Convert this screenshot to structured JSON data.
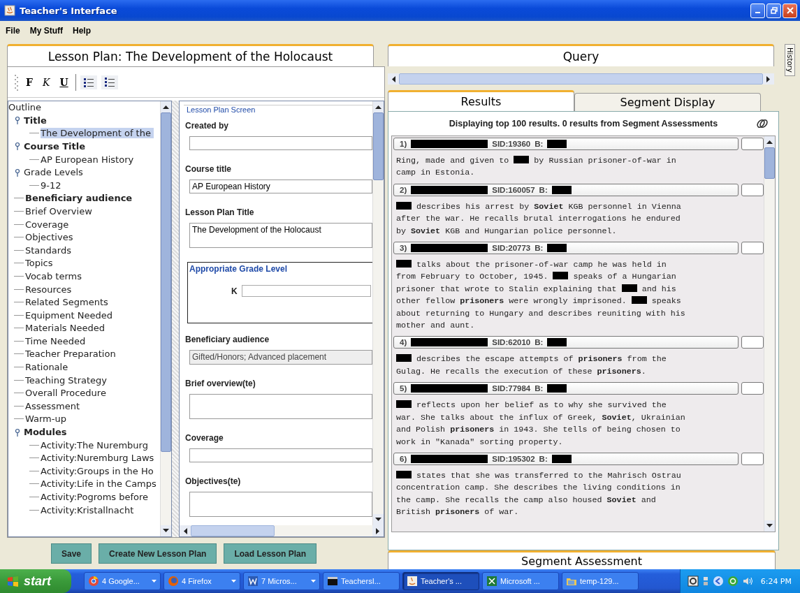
{
  "window": {
    "title": "Teacher's Interface"
  },
  "menu": [
    "File",
    "My Stuff",
    "Help"
  ],
  "lesson_tab": {
    "title": "Lesson Plan: The Development of the Holocaust"
  },
  "toolbar": [
    {
      "kind": "bold",
      "label": "F"
    },
    {
      "kind": "italic",
      "label": "K"
    },
    {
      "kind": "underline",
      "label": "U"
    },
    {
      "kind": "bullets"
    },
    {
      "kind": "numbers"
    }
  ],
  "outline": {
    "title": "Outline",
    "items": [
      {
        "label": "Title",
        "bold": true,
        "selected": false,
        "expanded": true,
        "children": [
          {
            "label": "The Development of the",
            "bold": false,
            "selected": true
          }
        ]
      },
      {
        "label": "Course Title",
        "bold": true,
        "selected": false,
        "expanded": true,
        "children": [
          {
            "label": "AP European History",
            "bold": false,
            "selected": false
          }
        ]
      },
      {
        "label": "Grade Levels",
        "bold": false,
        "selected": false,
        "expanded": true,
        "children": [
          {
            "label": "9-12",
            "bold": false,
            "selected": false
          }
        ]
      },
      {
        "label": "Beneficiary audience",
        "bold": true,
        "selected": false
      },
      {
        "label": "Brief Overview",
        "bold": false,
        "selected": false
      },
      {
        "label": "Coverage",
        "bold": false,
        "selected": false
      },
      {
        "label": "Objectives",
        "bold": false,
        "selected": false
      },
      {
        "label": "Standards",
        "bold": false,
        "selected": false
      },
      {
        "label": "Topics",
        "bold": false,
        "selected": false
      },
      {
        "label": "Vocab terms",
        "bold": false,
        "selected": false
      },
      {
        "label": "Resources",
        "bold": false,
        "selected": false
      },
      {
        "label": "Related Segments",
        "bold": false,
        "selected": false
      },
      {
        "label": "Equipment Needed",
        "bold": false,
        "selected": false
      },
      {
        "label": "Materials Needed",
        "bold": false,
        "selected": false
      },
      {
        "label": "Time Needed",
        "bold": false,
        "selected": false
      },
      {
        "label": "Teacher Preparation",
        "bold": false,
        "selected": false
      },
      {
        "label": "Rationale",
        "bold": false,
        "selected": false
      },
      {
        "label": "Teaching Strategy",
        "bold": false,
        "selected": false
      },
      {
        "label": "Overall Procedure",
        "bold": false,
        "selected": false
      },
      {
        "label": "Assessment",
        "bold": false,
        "selected": false
      },
      {
        "label": "Warm-up",
        "bold": false,
        "selected": false
      },
      {
        "label": "Modules",
        "bold": true,
        "selected": false,
        "expanded": true,
        "children": [
          {
            "label": "Activity:The Nuremburg",
            "bold": false,
            "selected": false
          },
          {
            "label": "Activity:Nuremburg Laws",
            "bold": false,
            "selected": false
          },
          {
            "label": "Activity:Groups in the Ho",
            "bold": false,
            "selected": false
          },
          {
            "label": "Activity:Life in the Camps",
            "bold": false,
            "selected": false
          },
          {
            "label": "Activity:Pogroms before",
            "bold": false,
            "selected": false
          },
          {
            "label": "Activity:Kristallnacht",
            "bold": false,
            "selected": false
          }
        ]
      }
    ]
  },
  "form": {
    "title": "Lesson Plan Screen",
    "fields": [
      {
        "kind": "input",
        "label": "Created by"
      },
      {
        "kind": "input",
        "label": "Course title",
        "value": "AP European History"
      },
      {
        "kind": "textarea",
        "label": "Lesson Plan Title",
        "value": "The Development of the Holocaust"
      },
      {
        "kind": "group",
        "label": "Appropriate Grade Level",
        "field_label": "K"
      },
      {
        "kind": "input",
        "label": "Beneficiary audience",
        "value": "Gifted/Honors; Advanced placement",
        "disabled": true
      },
      {
        "kind": "textarea",
        "label": "Brief overview(te)"
      },
      {
        "kind": "input",
        "label": "Coverage"
      },
      {
        "kind": "textarea",
        "label": "Objectives(te)"
      }
    ]
  },
  "buttons": [
    "Save",
    "Create New Lesson Plan",
    "Load Lesson Plan"
  ],
  "query_tab": {
    "title": "Query"
  },
  "result_tabs": [
    {
      "label": "Results",
      "selected": true
    },
    {
      "label": "Segment Display",
      "selected": false
    }
  ],
  "results": {
    "summary": "Displaying top 100 results. 0 results from Segment Assessments",
    "items": [
      {
        "number": "1)",
        "sid": "SID:19360",
        "b": "B:",
        "parts": [
          {
            "kind": "text",
            "text": "Ring, made and given to "
          },
          {
            "kind": "redacted"
          },
          {
            "kind": "text",
            "text": " by Russian prisoner-of-war in camp in Estonia."
          }
        ]
      },
      {
        "number": "2)",
        "sid": "SID:160057",
        "b": "B:",
        "parts": [
          {
            "kind": "redacted"
          },
          {
            "kind": "text",
            "text": " describes his arrest by **Soviet** KGB personnel in Vienna after the war. He recalls brutal interrogations he endured by **Soviet** KGB and Hungarian police personnel."
          }
        ]
      },
      {
        "number": "3)",
        "sid": "SID:20773",
        "b": "B:",
        "parts": [
          {
            "kind": "redacted"
          },
          {
            "kind": "text",
            "text": " talks about the prisoner-of-war camp he was held in from February to October, 1945. "
          },
          {
            "kind": "redacted"
          },
          {
            "kind": "text",
            "text": " speaks of a Hungarian prisoner that wrote to Stalin explaining that "
          },
          {
            "kind": "redacted"
          },
          {
            "kind": "text",
            "text": " and his other fellow **prisoners** were wrongly imprisoned. "
          },
          {
            "kind": "redacted"
          },
          {
            "kind": "text",
            "text": " speaks about returning to Hungary and describes reuniting with his mother and aunt."
          }
        ]
      },
      {
        "number": "4)",
        "sid": "SID:62010",
        "b": "B:",
        "parts": [
          {
            "kind": "redacted"
          },
          {
            "kind": "text",
            "text": " describes the escape attempts of **prisoners** from the Gulag. He recalls the execution of these **prisoners**."
          }
        ]
      },
      {
        "number": "5)",
        "sid": "SID:77984",
        "b": "B:",
        "parts": [
          {
            "kind": "redacted"
          },
          {
            "kind": "text",
            "text": " reflects upon her belief as to why she survived the war. She talks about the influx of Greek, **Soviet**, Ukrainian and Polish **prisoners** in 1943. She tells of being chosen to work in \"Kanada\" sorting property."
          }
        ]
      },
      {
        "number": "6)",
        "sid": "SID:195302",
        "b": "B:",
        "parts": [
          {
            "kind": "redacted"
          },
          {
            "kind": "text",
            "text": " states that she was transferred to the Mahrisch Ostrau concentration camp. She describes the living conditions in the camp. She recalls the camp also housed **Soviet** and British **prisoners** of war."
          }
        ]
      }
    ]
  },
  "assessment_tab": {
    "title": "Segment Assessment"
  },
  "history_tab": {
    "title": "History"
  },
  "taskbar": {
    "start": "start",
    "items": [
      {
        "label": "4 Google...",
        "kind": "browser",
        "selected": false,
        "menu": true
      },
      {
        "label": "4 Firefox",
        "kind": "fox",
        "selected": false,
        "menu": true
      },
      {
        "label": "7 Micros...",
        "kind": "word",
        "selected": false,
        "menu": true
      },
      {
        "label": "TeachersI...",
        "kind": "console",
        "selected": false,
        "menu": false
      },
      {
        "label": "Teacher's ...",
        "kind": "java",
        "selected": true,
        "menu": false
      },
      {
        "label": "Microsoft ...",
        "kind": "excel",
        "selected": false,
        "menu": false
      },
      {
        "label": "temp-129...",
        "kind": "folder",
        "selected": false,
        "menu": false
      }
    ],
    "clock": "6:24 PM"
  }
}
